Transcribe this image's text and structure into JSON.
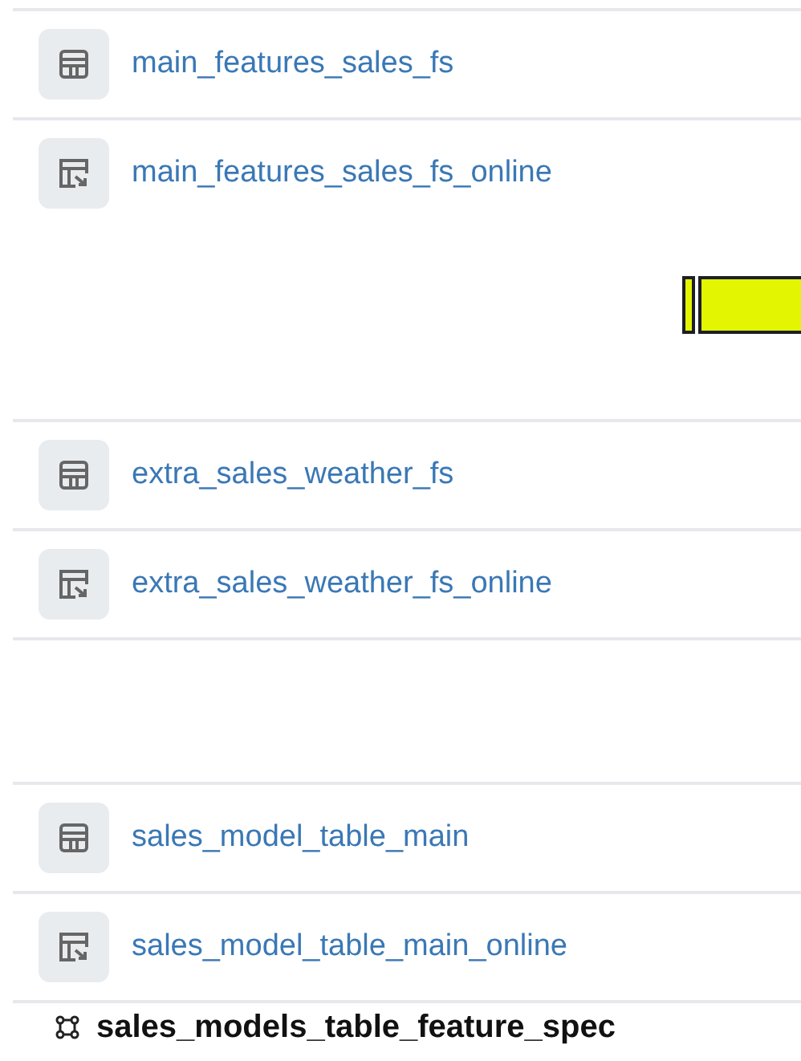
{
  "groups": [
    {
      "tables": [
        {
          "name": "main_features_sales_fs",
          "kind": "offline"
        },
        {
          "name": "main_features_sales_fs_online",
          "kind": "online"
        }
      ]
    },
    {
      "tables": [
        {
          "name": "extra_sales_weather_fs",
          "kind": "offline"
        },
        {
          "name": "extra_sales_weather_fs_online",
          "kind": "online"
        }
      ]
    },
    {
      "tables": [
        {
          "name": "sales_model_table_main",
          "kind": "offline"
        },
        {
          "name": "sales_model_table_main_online",
          "kind": "online"
        }
      ]
    }
  ],
  "feature_spec": {
    "name": "sales_models_table_feature_spec"
  }
}
